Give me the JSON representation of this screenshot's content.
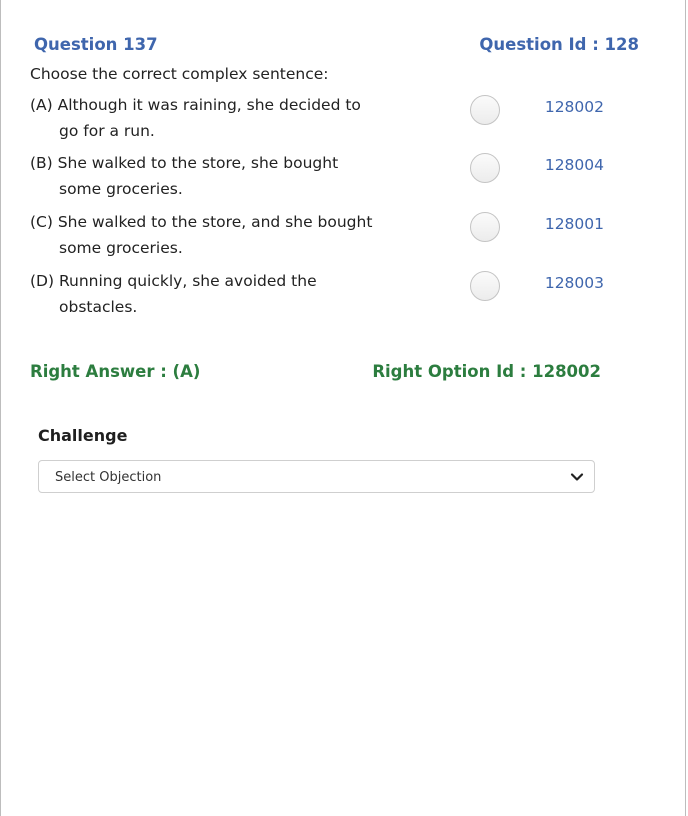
{
  "question": {
    "number_label": "Question 137",
    "id_label": "Question Id : 128",
    "text": "Choose the correct complex sentence:"
  },
  "options": [
    {
      "line1": "(A) Although it was raining, she decided to",
      "line2": "go for a run.",
      "id": "128002"
    },
    {
      "line1": "(B) She walked to the store, she bought",
      "line2": "some groceries.",
      "id": "128004"
    },
    {
      "line1": "(C) She walked to the store, and she bought",
      "line2": "some groceries.",
      "id": "128001"
    },
    {
      "line1": "(D) Running quickly, she avoided the",
      "line2": "obstacles.",
      "id": "128003"
    }
  ],
  "answer": {
    "right_answer": "Right Answer : (A)",
    "right_option_id": "Right Option Id : 128002"
  },
  "challenge": {
    "label": "Challenge",
    "select_value": "Select Objection",
    "chevron_icon": "chevron-down-icon"
  },
  "colors": {
    "blue": "#3f66ad",
    "green": "#2c7d3f"
  }
}
